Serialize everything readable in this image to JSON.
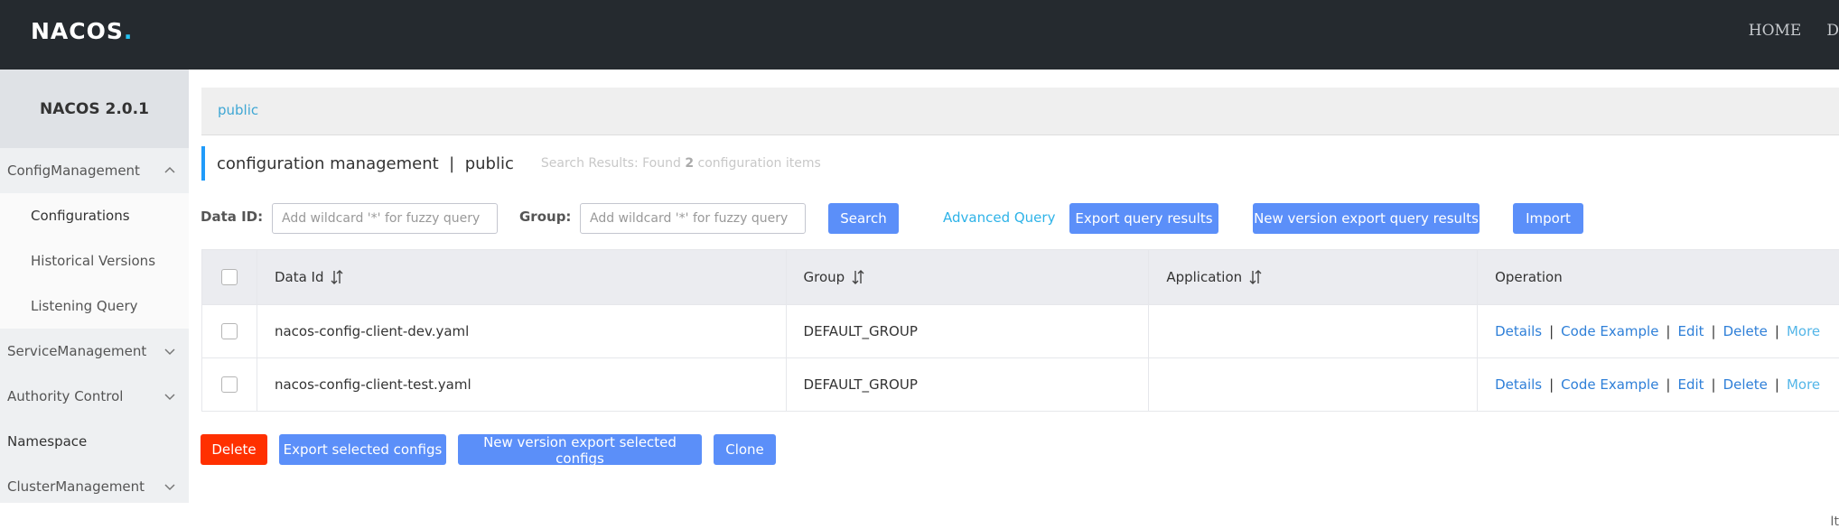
{
  "header": {
    "logo": "NACOS",
    "logo_dot": ".",
    "nav": [
      "HOME",
      "D"
    ]
  },
  "sidebar": {
    "title": "NACOS 2.0.1",
    "items": [
      {
        "label": "ConfigManagement",
        "type": "group",
        "expanded": true
      },
      {
        "label": "Configurations",
        "type": "sub"
      },
      {
        "label": "Historical Versions",
        "type": "sub"
      },
      {
        "label": "Listening Query",
        "type": "sub"
      },
      {
        "label": "ServiceManagement",
        "type": "group",
        "expanded": false
      },
      {
        "label": "Authority Control",
        "type": "group",
        "expanded": false
      },
      {
        "label": "Namespace",
        "type": "item"
      },
      {
        "label": "ClusterManagement",
        "type": "group",
        "expanded": false
      }
    ]
  },
  "namespace_bar": {
    "current": "public"
  },
  "page": {
    "title": "configuration management",
    "separator": "|",
    "namespace": "public",
    "results_prefix": "Search Results: Found ",
    "results_count": "2",
    "results_suffix": " configuration items"
  },
  "filters": {
    "data_id_label": "Data ID:",
    "data_id_value": "",
    "data_id_placeholder": "Add wildcard '*' for fuzzy query",
    "group_label": "Group:",
    "group_value": "",
    "group_placeholder": "Add wildcard '*' for fuzzy query",
    "search": "Search",
    "advanced": "Advanced Query",
    "export": "Export query results",
    "new_export": "New version export query results",
    "import": "Import"
  },
  "table": {
    "headers": [
      "Data Id",
      "Group",
      "Application",
      "Operation"
    ],
    "rows": [
      {
        "data_id": "nacos-config-client-dev.yaml",
        "group": "DEFAULT_GROUP",
        "application": ""
      },
      {
        "data_id": "nacos-config-client-test.yaml",
        "group": "DEFAULT_GROUP",
        "application": ""
      }
    ],
    "ops": {
      "details": "Details",
      "code": "Code Example",
      "edit": "Edit",
      "delete": "Delete",
      "more": "More",
      "sep": "|"
    }
  },
  "bulk": {
    "delete": "Delete",
    "export_selected": "Export selected configs",
    "new_export_selected": "New version export selected configs",
    "clone": "Clone"
  },
  "pagination": {
    "text": "It"
  },
  "colors": {
    "header_bg": "#252a2f",
    "primary": "#5b8ff9",
    "danger": "#ff3000",
    "link": "#2e7fd8",
    "accent": "#209bfa"
  }
}
